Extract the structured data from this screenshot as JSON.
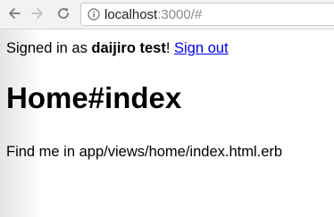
{
  "browser": {
    "url_host": "localhost",
    "url_rest": ":3000/#",
    "icons": {
      "back": "arrow-left-icon",
      "forward": "arrow-right-icon",
      "reload": "reload-icon",
      "site_info": "info-circle-icon"
    }
  },
  "page": {
    "notice_prefix": "Signed in as ",
    "user_name": "daijiro test",
    "notice_suffix": "! ",
    "sign_out_label": "Sign out",
    "title": "Home#index",
    "body_text": "Find me in app/views/home/index.html.erb"
  },
  "colors": {
    "link": "#0000ee",
    "url_muted": "#8a8a8a",
    "toolbar_bg": "#f2f2f2"
  }
}
